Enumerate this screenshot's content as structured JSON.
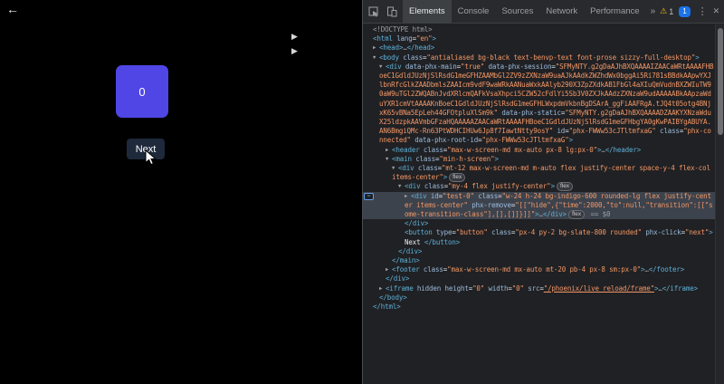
{
  "page": {
    "back_arrow": "←",
    "triangle_marker": "▶",
    "counter_value": "0",
    "next_button_label": "Next",
    "colors": {
      "background": "#000000",
      "counter_box": "#4f46e5",
      "next_button": "#1e293b"
    }
  },
  "devtools": {
    "tabs": [
      "Elements",
      "Console",
      "Sources",
      "Network",
      "Performance"
    ],
    "selected_tab": "Elements",
    "more_icon": "»",
    "warning_icon": "⚠",
    "warning_count": "1",
    "issues_count": "1",
    "menu_icon": "⋮",
    "close_icon": "✕",
    "selected_node_hint": "== $0",
    "colors": {
      "toolbar_bg": "#292a2d",
      "panel_bg": "#202124",
      "tag": "#5db0d7",
      "attribute_name": "#9bbbdc",
      "attribute_value": "#f29766",
      "selection": "#3d434d",
      "issues_badge": "#1a73e8",
      "warning": "#f4c20d"
    },
    "tree": {
      "lines": [
        {
          "indent": 0,
          "segs": [
            [
              "dim",
              "<!DOCTYPE html>"
            ]
          ]
        },
        {
          "indent": 0,
          "segs": [
            [
              "tag",
              "<html"
            ],
            [
              "an",
              " lang"
            ],
            [
              "p",
              "="
            ],
            [
              "av",
              "\"en\""
            ],
            [
              "tag",
              ">"
            ]
          ]
        },
        {
          "indent": 1,
          "segs": [
            [
              "arrow",
              "▶"
            ],
            [
              "tag",
              "<head"
            ],
            [
              "tag",
              ">"
            ],
            [
              "dim",
              "…"
            ],
            [
              "tag",
              "</head>"
            ]
          ]
        },
        {
          "indent": 1,
          "segs": [
            [
              "arrow",
              "▼"
            ],
            [
              "tag",
              "<body"
            ],
            [
              "an",
              " class"
            ],
            [
              "p",
              "="
            ],
            [
              "av",
              "\"antialiased bg-black text-benvp-text font-prose sizzy-full-desktop\""
            ],
            [
              "tag",
              ">"
            ]
          ]
        },
        {
          "indent": 2,
          "segs": [
            [
              "arrow",
              "▼"
            ],
            [
              "tag",
              "<div"
            ],
            [
              "an",
              " data-phx-main"
            ],
            [
              "p",
              "="
            ],
            [
              "av",
              "\"true\""
            ],
            [
              "an",
              " data-phx-session"
            ],
            [
              "p",
              "="
            ],
            [
              "av",
              "\"SFMyNTY.g2gDaAJhBXQAAAAIZAACaWRtAAAAFHBoeC1GdldJUzNjSlRsdG1meGFHZAAMbGl2ZV9zZXNzaW9uaAJkAAdkZWZhdWx0bggAi5Ri781sBBdkAApwYXJlbnRfcGlkZAADbmlsZAAIcm9vdF9waWRkAANuaWxkAAlyb290X3ZpZXdkAB1FbGl4aXIuQmVudnBXZWIuTW90aW9uTGl2ZWQABnJvdXRlcmQAFkVsaXhpci5CZW52cFdlYi5Sb3V0ZXJkAAdzZXNzaW9udAAAAABkAApzaWduYXR1cmVtAAAAKnBoeC1GdldJUzNjSlRsdG1meGFHLWxpdmVkbnBgDSArA_ggFiAAFRgA.tJQ4t05otg4BNjxK65vBNa5EpLeh44GFOtpluXlSm9k\""
            ],
            [
              "an",
              " data-phx-static"
            ],
            [
              "p",
              "="
            ],
            [
              "av",
              "\"SFMyNTY.g2gDaAJhBXQAAAADZAAKYXNzaWduX25ldzpkAAVmbGFzaHQAAAAAZAACaWRtAAAAFHBoeC1GdldJUzNjSlRsdG1meGFHbgYA0gKwPAIBYgABUYA.AN6BmgiQMc-Rn63PtWDHCIHUw6Jp8f7IawtNtty9osY\""
            ],
            [
              "an",
              " id"
            ],
            [
              "p",
              "="
            ],
            [
              "av",
              "\"phx-FWWw53cJTltmfxaG\""
            ],
            [
              "an",
              " class"
            ],
            [
              "p",
              "="
            ],
            [
              "av",
              "\"phx-connected\""
            ],
            [
              "an",
              " data-phx-root-id"
            ],
            [
              "p",
              "="
            ],
            [
              "av",
              "\"phx-FWWw53cJTltmfxaG\""
            ],
            [
              "tag",
              ">"
            ]
          ]
        },
        {
          "indent": 3,
          "segs": [
            [
              "arrow",
              "▶"
            ],
            [
              "tag",
              "<header"
            ],
            [
              "an",
              " class"
            ],
            [
              "p",
              "="
            ],
            [
              "av",
              "\"max-w-screen-md mx-auto px-8 lg:px-0\""
            ],
            [
              "tag",
              ">"
            ],
            [
              "dim",
              "…"
            ],
            [
              "tag",
              "</header>"
            ]
          ]
        },
        {
          "indent": 3,
          "segs": [
            [
              "arrow",
              "▼"
            ],
            [
              "tag",
              "<main"
            ],
            [
              "an",
              " class"
            ],
            [
              "p",
              "="
            ],
            [
              "av",
              "\"min-h-screen\""
            ],
            [
              "tag",
              ">"
            ]
          ]
        },
        {
          "indent": 4,
          "segs": [
            [
              "arrow",
              "▼"
            ],
            [
              "tag",
              "<div"
            ],
            [
              "an",
              " class"
            ],
            [
              "p",
              "="
            ],
            [
              "av",
              "\"mt-12 max-w-screen-md m-auto flex justify-center space-y-4 flex-col items-center\""
            ],
            [
              "tag",
              ">"
            ],
            [
              "badge",
              "flex"
            ]
          ]
        },
        {
          "indent": 5,
          "segs": [
            [
              "arrow",
              "▼"
            ],
            [
              "tag",
              "<div"
            ],
            [
              "an",
              " class"
            ],
            [
              "p",
              "="
            ],
            [
              "av",
              "\"my-4 flex justify-center\""
            ],
            [
              "tag",
              ">"
            ],
            [
              "badge",
              "flex"
            ]
          ]
        },
        {
          "indent": 6,
          "selected": true,
          "adorner": "⋯",
          "segs": [
            [
              "arrow",
              "▶"
            ],
            [
              "tag",
              "<div"
            ],
            [
              "an",
              " id"
            ],
            [
              "p",
              "="
            ],
            [
              "av",
              "\"test-0\""
            ],
            [
              "an",
              " class"
            ],
            [
              "p",
              "="
            ],
            [
              "av",
              "\"w-24 h-24 bg-indigo-600 rounded-lg flex justify-center items-center\""
            ],
            [
              "an",
              " phx-remove"
            ],
            [
              "p",
              "="
            ],
            [
              "av",
              "\"[[\"hide\",{\"time\":2000,\"to\":null,\"transition\":[[\"some-transition-class\"],[],[]]}]]\""
            ],
            [
              "tag",
              ">"
            ],
            [
              "dim",
              "…"
            ],
            [
              "tag",
              "</div>"
            ],
            [
              "badge",
              "flex"
            ],
            [
              "dim",
              " == $0"
            ]
          ]
        },
        {
          "indent": 5,
          "segs": [
            [
              "tag",
              "</div>"
            ]
          ]
        },
        {
          "indent": 5,
          "segs": [
            [
              "tag",
              "<button"
            ],
            [
              "an",
              " type"
            ],
            [
              "p",
              "="
            ],
            [
              "av",
              "\"button\""
            ],
            [
              "an",
              " class"
            ],
            [
              "p",
              "="
            ],
            [
              "av",
              "\"px-4 py-2 bg-slate-800 rounded\""
            ],
            [
              "an",
              " phx-click"
            ],
            [
              "p",
              "="
            ],
            [
              "av",
              "\"next\""
            ],
            [
              "tag",
              ">"
            ],
            [
              "txt",
              " Next "
            ],
            [
              "tag",
              "</button>"
            ]
          ]
        },
        {
          "indent": 4,
          "segs": [
            [
              "tag",
              "</div>"
            ]
          ]
        },
        {
          "indent": 3,
          "segs": [
            [
              "tag",
              "</main>"
            ]
          ]
        },
        {
          "indent": 3,
          "segs": [
            [
              "arrow",
              "▶"
            ],
            [
              "tag",
              "<footer"
            ],
            [
              "an",
              " class"
            ],
            [
              "p",
              "="
            ],
            [
              "av",
              "\"max-w-screen-md mx-auto mt-20 pb-4 px-8 sm:px-0\""
            ],
            [
              "tag",
              ">"
            ],
            [
              "dim",
              "…"
            ],
            [
              "tag",
              "</footer>"
            ]
          ]
        },
        {
          "indent": 2,
          "segs": [
            [
              "tag",
              "</div>"
            ]
          ]
        },
        {
          "indent": 2,
          "segs": [
            [
              "arrow",
              "▶"
            ],
            [
              "tag",
              "<iframe"
            ],
            [
              "an",
              " hidden"
            ],
            [
              "an",
              " height"
            ],
            [
              "p",
              "="
            ],
            [
              "av",
              "\"0\""
            ],
            [
              "an",
              " width"
            ],
            [
              "p",
              "="
            ],
            [
              "av",
              "\"0\""
            ],
            [
              "an",
              " src"
            ],
            [
              "p",
              "="
            ],
            [
              "link",
              "\"/phoenix/live_reload/frame\""
            ],
            [
              "tag",
              ">"
            ],
            [
              "dim",
              "…"
            ],
            [
              "tag",
              "</iframe>"
            ]
          ]
        },
        {
          "indent": 1,
          "segs": [
            [
              "tag",
              "</body>"
            ]
          ]
        },
        {
          "indent": 0,
          "segs": [
            [
              "tag",
              "</html>"
            ]
          ]
        }
      ]
    }
  }
}
